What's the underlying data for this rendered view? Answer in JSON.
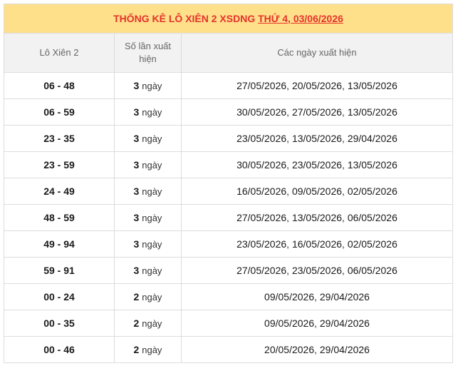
{
  "title": {
    "prefix": "THỐNG KÊ LÔ XIÊN 2 XSDNG ",
    "date": "THỨ 4, 03/06/2026"
  },
  "headers": {
    "pair": "Lô Xiên 2",
    "count": "Số lần xuất hiện",
    "dates": "Các ngày xuất hiện"
  },
  "count_unit": "ngày",
  "rows": [
    {
      "pair": "06 - 48",
      "count": "3",
      "dates": [
        "27/05/2026",
        "20/05/2026",
        "13/05/2026"
      ]
    },
    {
      "pair": "06 - 59",
      "count": "3",
      "dates": [
        "30/05/2026",
        "27/05/2026",
        "13/05/2026"
      ]
    },
    {
      "pair": "23 - 35",
      "count": "3",
      "dates": [
        "23/05/2026",
        "13/05/2026",
        "29/04/2026"
      ]
    },
    {
      "pair": "23 - 59",
      "count": "3",
      "dates": [
        "30/05/2026",
        "23/05/2026",
        "13/05/2026"
      ]
    },
    {
      "pair": "24 - 49",
      "count": "3",
      "dates": [
        "16/05/2026",
        "09/05/2026",
        "02/05/2026"
      ]
    },
    {
      "pair": "48 - 59",
      "count": "3",
      "dates": [
        "27/05/2026",
        "13/05/2026",
        "06/05/2026"
      ]
    },
    {
      "pair": "49 - 94",
      "count": "3",
      "dates": [
        "23/05/2026",
        "16/05/2026",
        "02/05/2026"
      ]
    },
    {
      "pair": "59 - 91",
      "count": "3",
      "dates": [
        "27/05/2026",
        "23/05/2026",
        "06/05/2026"
      ]
    },
    {
      "pair": "00 - 24",
      "count": "2",
      "dates": [
        "09/05/2026",
        "29/04/2026"
      ]
    },
    {
      "pair": "00 - 35",
      "count": "2",
      "dates": [
        "09/05/2026",
        "29/04/2026"
      ]
    },
    {
      "pair": "00 - 46",
      "count": "2",
      "dates": [
        "20/05/2026",
        "29/04/2026"
      ]
    }
  ],
  "colors": {
    "title_bg": "#ffe08a",
    "title_text": "#e4322b",
    "date_link": "#1a3fa8",
    "header_bg": "#f2f2f2"
  }
}
